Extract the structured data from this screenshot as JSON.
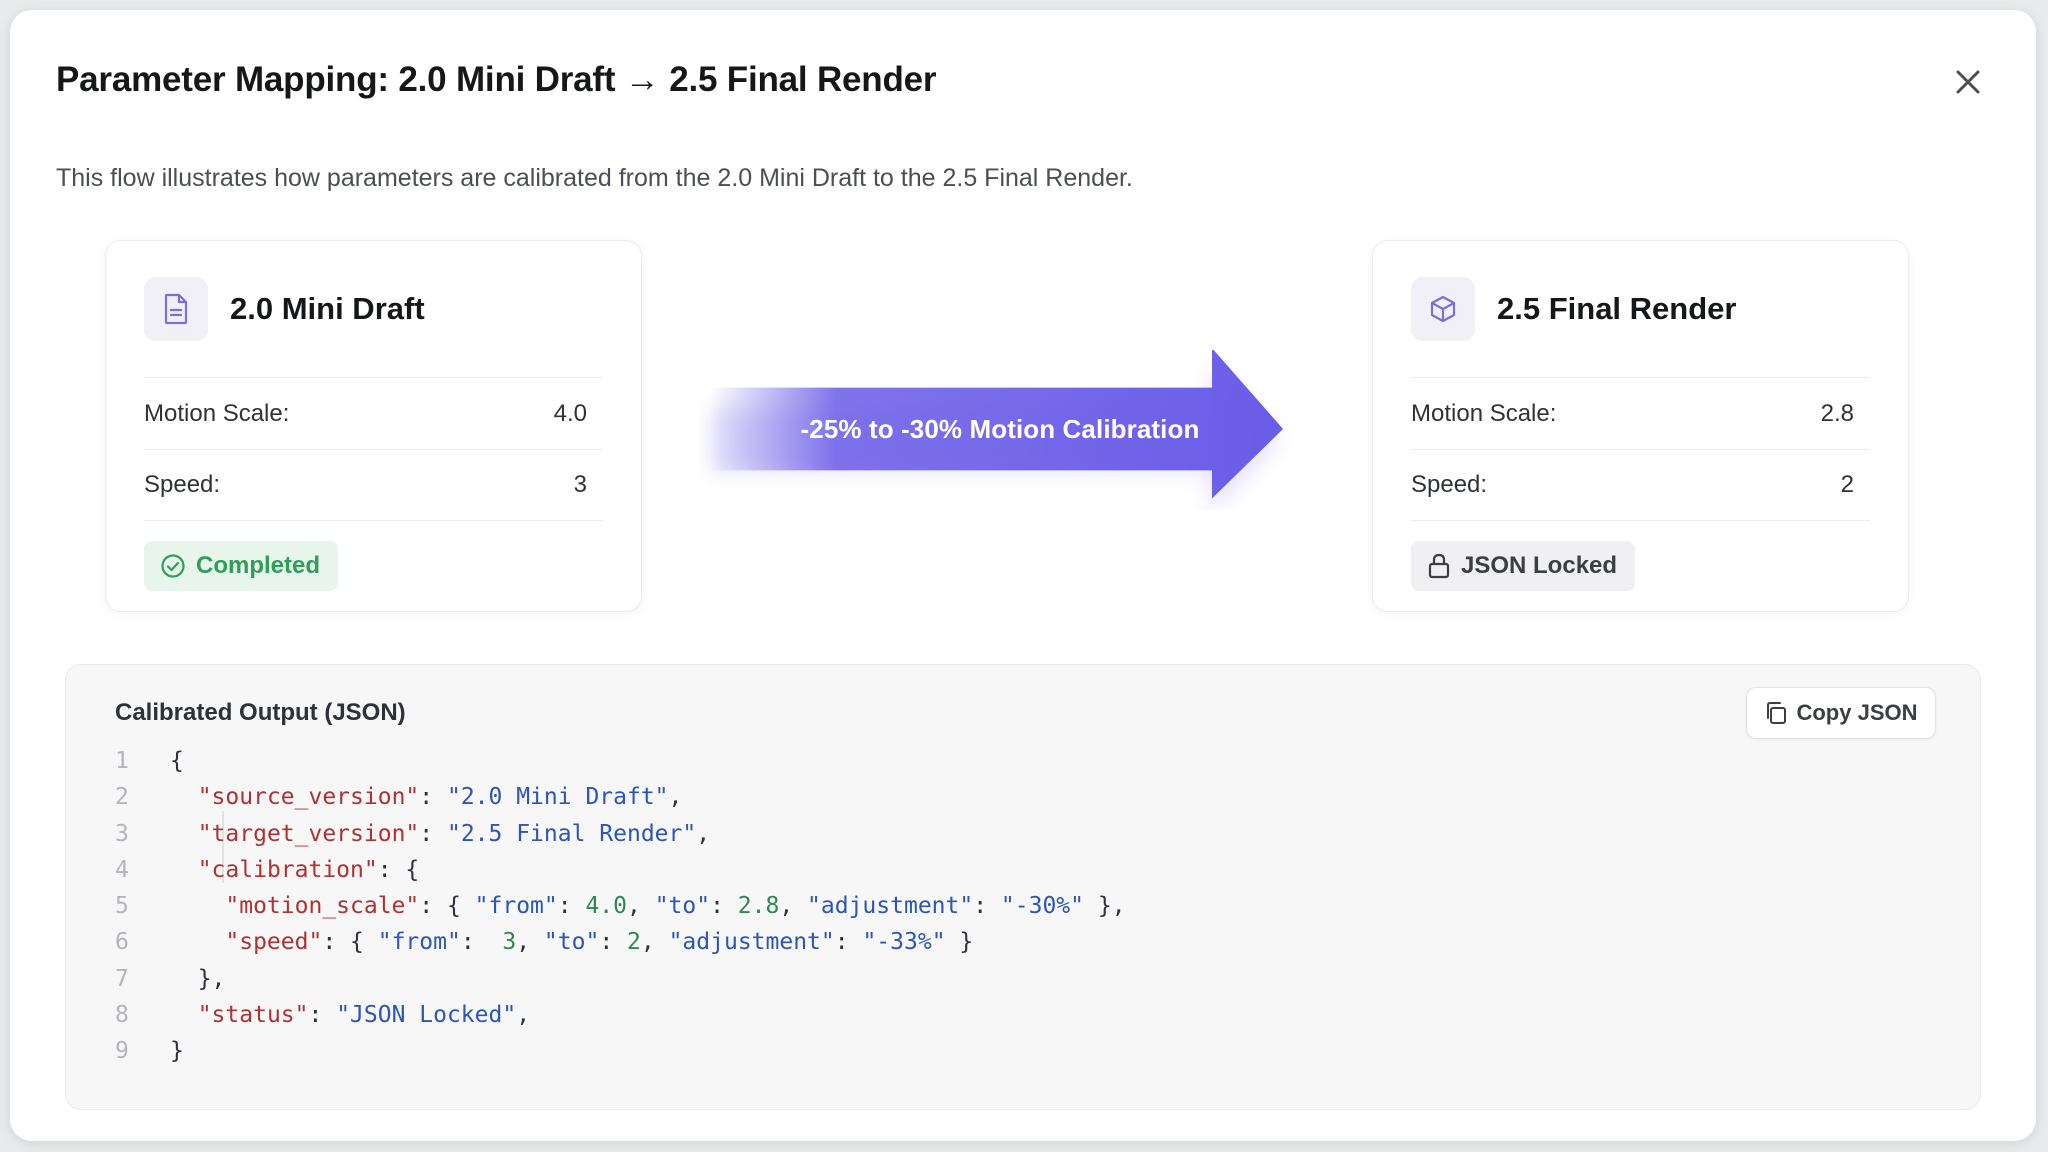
{
  "dialog": {
    "title": "Parameter Mapping: 2.0 Mini Draft → 2.5 Final Render",
    "description": "This flow illustrates how parameters are calibrated from the 2.0 Mini Draft to the 2.5 Final Render.",
    "close_icon": "close-icon"
  },
  "source_card": {
    "icon": "document-icon",
    "title": "2.0 Mini Draft",
    "rows": [
      {
        "label": "Motion Scale:",
        "value": "4.0"
      },
      {
        "label": "Speed:",
        "value": "3"
      }
    ],
    "badge": {
      "icon": "check-circle-icon",
      "label": "Completed",
      "color": "#2f9e56"
    }
  },
  "arrow": {
    "label": "-25% to -30% Motion Calibration",
    "color": "#6b5ce7"
  },
  "target_card": {
    "icon": "cube-icon",
    "title": "2.5 Final Render",
    "rows": [
      {
        "label": "Motion Scale:",
        "value": "2.8"
      },
      {
        "label": "Speed:",
        "value": "2"
      }
    ],
    "badge": {
      "icon": "lock-icon",
      "label": "JSON Locked"
    }
  },
  "json_panel": {
    "title": "Calibrated Output (JSON)",
    "copy_label": "Copy JSON",
    "copy_icon": "copy-icon",
    "lines": [
      {
        "n": "1",
        "segs": [
          {
            "t": "{",
            "c": "c"
          }
        ]
      },
      {
        "n": "2",
        "segs": [
          {
            "t": "  ",
            "c": "c"
          },
          {
            "t": "\"source_version\"",
            "c": "k"
          },
          {
            "t": ": ",
            "c": "c"
          },
          {
            "t": "\"2.0 Mini Draft\"",
            "c": "s"
          },
          {
            "t": ",",
            "c": "c"
          }
        ]
      },
      {
        "n": "3",
        "segs": [
          {
            "t": "  ",
            "c": "c"
          },
          {
            "t": "\"target_version\"",
            "c": "k"
          },
          {
            "t": ": ",
            "c": "c"
          },
          {
            "t": "\"2.5 Final Render\"",
            "c": "s"
          },
          {
            "t": ",",
            "c": "c"
          }
        ]
      },
      {
        "n": "4",
        "segs": [
          {
            "t": "  ",
            "c": "c"
          },
          {
            "t": "\"calibration\"",
            "c": "k"
          },
          {
            "t": ": {",
            "c": "c"
          }
        ]
      },
      {
        "n": "5",
        "segs": [
          {
            "t": "    ",
            "c": "c"
          },
          {
            "t": "\"motion_scale\"",
            "c": "k"
          },
          {
            "t": ": { ",
            "c": "c"
          },
          {
            "t": "\"from\"",
            "c": "s"
          },
          {
            "t": ": ",
            "c": "c"
          },
          {
            "t": "4.0",
            "c": "n"
          },
          {
            "t": ", ",
            "c": "c"
          },
          {
            "t": "\"to\"",
            "c": "s"
          },
          {
            "t": ": ",
            "c": "c"
          },
          {
            "t": "2.8",
            "c": "n"
          },
          {
            "t": ", ",
            "c": "c"
          },
          {
            "t": "\"adjustment\"",
            "c": "s"
          },
          {
            "t": ": ",
            "c": "c"
          },
          {
            "t": "\"-30%\"",
            "c": "s"
          },
          {
            "t": " },",
            "c": "c"
          }
        ]
      },
      {
        "n": "6",
        "segs": [
          {
            "t": "    ",
            "c": "c"
          },
          {
            "t": "\"speed\"",
            "c": "k"
          },
          {
            "t": ": { ",
            "c": "c"
          },
          {
            "t": "\"from\"",
            "c": "s"
          },
          {
            "t": ":  ",
            "c": "c"
          },
          {
            "t": "3",
            "c": "n"
          },
          {
            "t": ", ",
            "c": "c"
          },
          {
            "t": "\"to\"",
            "c": "s"
          },
          {
            "t": ": ",
            "c": "c"
          },
          {
            "t": "2",
            "c": "n"
          },
          {
            "t": ", ",
            "c": "c"
          },
          {
            "t": "\"adjustment\"",
            "c": "s"
          },
          {
            "t": ": ",
            "c": "c"
          },
          {
            "t": "\"-33%\"",
            "c": "s"
          },
          {
            "t": " }",
            "c": "c"
          }
        ]
      },
      {
        "n": "7",
        "segs": [
          {
            "t": "  },",
            "c": "c"
          }
        ]
      },
      {
        "n": "8",
        "segs": [
          {
            "t": "  ",
            "c": "c"
          },
          {
            "t": "\"status\"",
            "c": "k"
          },
          {
            "t": ": ",
            "c": "c"
          },
          {
            "t": "\"JSON Locked\"",
            "c": "s"
          },
          {
            "t": ",",
            "c": "c"
          }
        ]
      },
      {
        "n": "9",
        "segs": [
          {
            "t": "}",
            "c": "c"
          }
        ]
      }
    ]
  }
}
